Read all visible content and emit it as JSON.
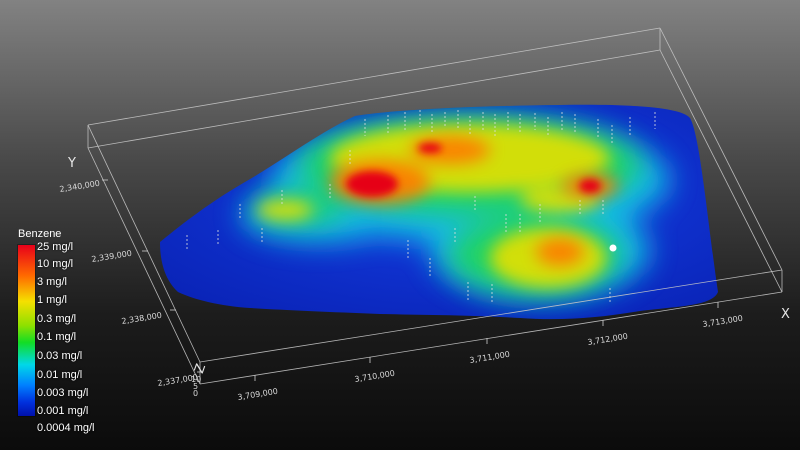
{
  "legend": {
    "title": "Benzene",
    "labels": [
      "25 mg/l",
      "10 mg/l",
      "3 mg/l",
      "1 mg/l",
      "0.3 mg/l",
      "0.1 mg/l",
      "0.03 mg/l",
      "0.01 mg/l",
      "0.003 mg/l",
      "0.001 mg/l",
      "0.0004 mg/l"
    ]
  },
  "axes": {
    "x_letter": "X",
    "y_letter": "Y",
    "z_letter": "Z",
    "x_ticks": [
      "3,709,000",
      "3,710,000",
      "3,711,000",
      "3,712,000",
      "3,713,000"
    ],
    "y_ticks": [
      "2,340,000",
      "2,339,000",
      "2,338,000",
      "2,337,000"
    ],
    "z_ticks": [
      "10",
      "5",
      "0"
    ]
  },
  "colors": {
    "background_top": "#828282",
    "background_bottom": "#0b0b0b",
    "box_lines": "#c8c8c8",
    "surface_base": "#0a2dd2",
    "plume_high": "#e8001a",
    "plume_low": "#0010aa"
  }
}
